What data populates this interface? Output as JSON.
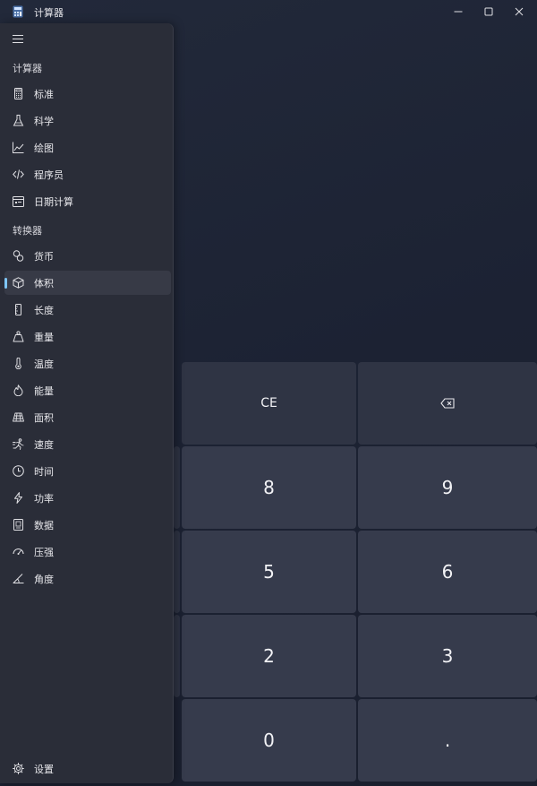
{
  "window": {
    "title": "计算器"
  },
  "nav": {
    "section_calculator": "计算器",
    "section_converter": "转换器",
    "calculator_items": [
      {
        "label": "标准",
        "icon": "calculator-icon"
      },
      {
        "label": "科学",
        "icon": "flask-icon"
      },
      {
        "label": "绘图",
        "icon": "graph-icon"
      },
      {
        "label": "程序员",
        "icon": "code-icon"
      },
      {
        "label": "日期计算",
        "icon": "calendar-icon"
      }
    ],
    "converter_items": [
      {
        "label": "货币",
        "icon": "currency-icon"
      },
      {
        "label": "体积",
        "icon": "cube-icon",
        "selected": true
      },
      {
        "label": "长度",
        "icon": "ruler-icon"
      },
      {
        "label": "重量",
        "icon": "weight-icon"
      },
      {
        "label": "温度",
        "icon": "thermometer-icon"
      },
      {
        "label": "能量",
        "icon": "flame-icon"
      },
      {
        "label": "面积",
        "icon": "area-icon"
      },
      {
        "label": "速度",
        "icon": "speed-icon"
      },
      {
        "label": "时间",
        "icon": "clock-icon"
      },
      {
        "label": "功率",
        "icon": "lightning-icon"
      },
      {
        "label": "数据",
        "icon": "data-icon"
      },
      {
        "label": "压强",
        "icon": "gauge-icon"
      },
      {
        "label": "角度",
        "icon": "angle-icon"
      }
    ],
    "settings_label": "设置"
  },
  "keypad": {
    "ce": "CE",
    "k8": "8",
    "k9": "9",
    "k5": "5",
    "k6": "6",
    "k2": "2",
    "k3": "3",
    "k0": "0",
    "dot": "."
  },
  "colors": {
    "accent": "#7fc6f7",
    "pane": "#2a2d38",
    "key": "#363b4c"
  }
}
